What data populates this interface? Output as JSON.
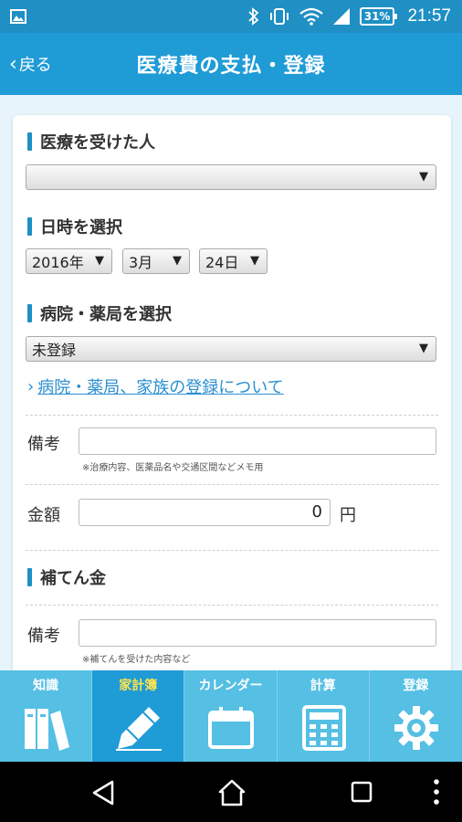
{
  "status_bar": {
    "battery": "31%",
    "time": "21:57"
  },
  "header": {
    "back_label": "戻る",
    "title": "医療費の支払・登録"
  },
  "form": {
    "patient": {
      "heading": "医療を受けた人",
      "value": ""
    },
    "date": {
      "heading": "日時を選択",
      "year": "2016年",
      "month": "3月",
      "day": "24日"
    },
    "hospital": {
      "heading": "病院・薬局を選択",
      "value": "未登録"
    },
    "link_text": "病院・薬局、家族の登録について",
    "memo": {
      "label": "備考",
      "value": "",
      "hint": "※治療内容、医薬品名や交通区間などメモ用"
    },
    "amount": {
      "label": "金額",
      "value": "0",
      "unit": "円"
    },
    "subsidy": {
      "heading": "補てん金",
      "memo_label": "備考",
      "memo_value": "",
      "memo_hint": "※補てんを受けた内容など"
    }
  },
  "tabs": [
    {
      "label": "知識",
      "icon": "books-icon"
    },
    {
      "label": "家計簿",
      "icon": "pencil-icon",
      "active": true
    },
    {
      "label": "カレンダー",
      "icon": "calendar-icon"
    },
    {
      "label": "計算",
      "icon": "calculator-icon"
    },
    {
      "label": "登録",
      "icon": "gear-icon"
    }
  ],
  "colors": {
    "primary": "#1f9bd6",
    "tab_bar": "#55bfe4",
    "active_tab_label": "#ffe44d",
    "link": "#2a8fd0"
  }
}
